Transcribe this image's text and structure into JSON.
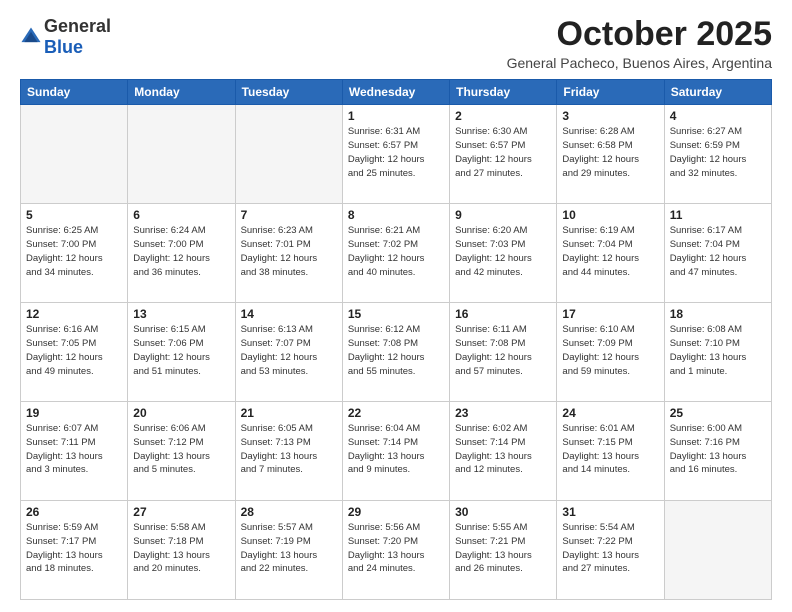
{
  "header": {
    "logo_general": "General",
    "logo_blue": "Blue",
    "month": "October 2025",
    "location": "General Pacheco, Buenos Aires, Argentina"
  },
  "days_of_week": [
    "Sunday",
    "Monday",
    "Tuesday",
    "Wednesday",
    "Thursday",
    "Friday",
    "Saturday"
  ],
  "weeks": [
    [
      {
        "day": "",
        "info": ""
      },
      {
        "day": "",
        "info": ""
      },
      {
        "day": "",
        "info": ""
      },
      {
        "day": "1",
        "info": "Sunrise: 6:31 AM\nSunset: 6:57 PM\nDaylight: 12 hours\nand 25 minutes."
      },
      {
        "day": "2",
        "info": "Sunrise: 6:30 AM\nSunset: 6:57 PM\nDaylight: 12 hours\nand 27 minutes."
      },
      {
        "day": "3",
        "info": "Sunrise: 6:28 AM\nSunset: 6:58 PM\nDaylight: 12 hours\nand 29 minutes."
      },
      {
        "day": "4",
        "info": "Sunrise: 6:27 AM\nSunset: 6:59 PM\nDaylight: 12 hours\nand 32 minutes."
      }
    ],
    [
      {
        "day": "5",
        "info": "Sunrise: 6:25 AM\nSunset: 7:00 PM\nDaylight: 12 hours\nand 34 minutes."
      },
      {
        "day": "6",
        "info": "Sunrise: 6:24 AM\nSunset: 7:00 PM\nDaylight: 12 hours\nand 36 minutes."
      },
      {
        "day": "7",
        "info": "Sunrise: 6:23 AM\nSunset: 7:01 PM\nDaylight: 12 hours\nand 38 minutes."
      },
      {
        "day": "8",
        "info": "Sunrise: 6:21 AM\nSunset: 7:02 PM\nDaylight: 12 hours\nand 40 minutes."
      },
      {
        "day": "9",
        "info": "Sunrise: 6:20 AM\nSunset: 7:03 PM\nDaylight: 12 hours\nand 42 minutes."
      },
      {
        "day": "10",
        "info": "Sunrise: 6:19 AM\nSunset: 7:04 PM\nDaylight: 12 hours\nand 44 minutes."
      },
      {
        "day": "11",
        "info": "Sunrise: 6:17 AM\nSunset: 7:04 PM\nDaylight: 12 hours\nand 47 minutes."
      }
    ],
    [
      {
        "day": "12",
        "info": "Sunrise: 6:16 AM\nSunset: 7:05 PM\nDaylight: 12 hours\nand 49 minutes."
      },
      {
        "day": "13",
        "info": "Sunrise: 6:15 AM\nSunset: 7:06 PM\nDaylight: 12 hours\nand 51 minutes."
      },
      {
        "day": "14",
        "info": "Sunrise: 6:13 AM\nSunset: 7:07 PM\nDaylight: 12 hours\nand 53 minutes."
      },
      {
        "day": "15",
        "info": "Sunrise: 6:12 AM\nSunset: 7:08 PM\nDaylight: 12 hours\nand 55 minutes."
      },
      {
        "day": "16",
        "info": "Sunrise: 6:11 AM\nSunset: 7:08 PM\nDaylight: 12 hours\nand 57 minutes."
      },
      {
        "day": "17",
        "info": "Sunrise: 6:10 AM\nSunset: 7:09 PM\nDaylight: 12 hours\nand 59 minutes."
      },
      {
        "day": "18",
        "info": "Sunrise: 6:08 AM\nSunset: 7:10 PM\nDaylight: 13 hours\nand 1 minute."
      }
    ],
    [
      {
        "day": "19",
        "info": "Sunrise: 6:07 AM\nSunset: 7:11 PM\nDaylight: 13 hours\nand 3 minutes."
      },
      {
        "day": "20",
        "info": "Sunrise: 6:06 AM\nSunset: 7:12 PM\nDaylight: 13 hours\nand 5 minutes."
      },
      {
        "day": "21",
        "info": "Sunrise: 6:05 AM\nSunset: 7:13 PM\nDaylight: 13 hours\nand 7 minutes."
      },
      {
        "day": "22",
        "info": "Sunrise: 6:04 AM\nSunset: 7:14 PM\nDaylight: 13 hours\nand 9 minutes."
      },
      {
        "day": "23",
        "info": "Sunrise: 6:02 AM\nSunset: 7:14 PM\nDaylight: 13 hours\nand 12 minutes."
      },
      {
        "day": "24",
        "info": "Sunrise: 6:01 AM\nSunset: 7:15 PM\nDaylight: 13 hours\nand 14 minutes."
      },
      {
        "day": "25",
        "info": "Sunrise: 6:00 AM\nSunset: 7:16 PM\nDaylight: 13 hours\nand 16 minutes."
      }
    ],
    [
      {
        "day": "26",
        "info": "Sunrise: 5:59 AM\nSunset: 7:17 PM\nDaylight: 13 hours\nand 18 minutes."
      },
      {
        "day": "27",
        "info": "Sunrise: 5:58 AM\nSunset: 7:18 PM\nDaylight: 13 hours\nand 20 minutes."
      },
      {
        "day": "28",
        "info": "Sunrise: 5:57 AM\nSunset: 7:19 PM\nDaylight: 13 hours\nand 22 minutes."
      },
      {
        "day": "29",
        "info": "Sunrise: 5:56 AM\nSunset: 7:20 PM\nDaylight: 13 hours\nand 24 minutes."
      },
      {
        "day": "30",
        "info": "Sunrise: 5:55 AM\nSunset: 7:21 PM\nDaylight: 13 hours\nand 26 minutes."
      },
      {
        "day": "31",
        "info": "Sunrise: 5:54 AM\nSunset: 7:22 PM\nDaylight: 13 hours\nand 27 minutes."
      },
      {
        "day": "",
        "info": ""
      }
    ]
  ]
}
